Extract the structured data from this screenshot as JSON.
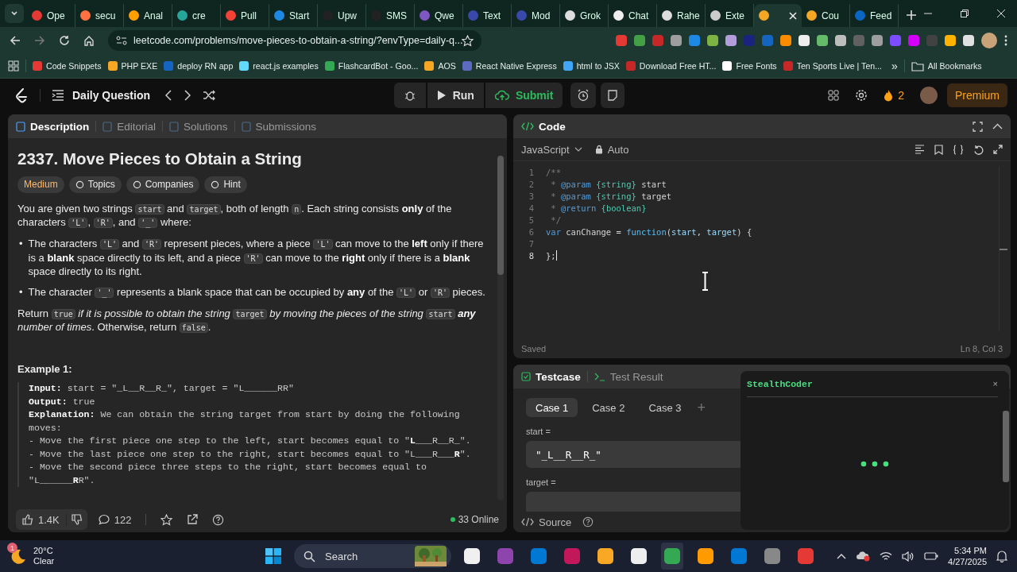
{
  "browser": {
    "tabs": [
      {
        "label": "Ope",
        "selected": false
      },
      {
        "label": "secu",
        "selected": false
      },
      {
        "label": "Anal",
        "selected": false
      },
      {
        "label": "cre",
        "selected": false
      },
      {
        "label": "Pull",
        "selected": false
      },
      {
        "label": "Start",
        "selected": false
      },
      {
        "label": "Upw",
        "selected": false
      },
      {
        "label": "SMS",
        "selected": false
      },
      {
        "label": "Qwe",
        "selected": false
      },
      {
        "label": "Text",
        "selected": false
      },
      {
        "label": "Mod",
        "selected": false
      },
      {
        "label": "Grok",
        "selected": false
      },
      {
        "label": "Chat",
        "selected": false
      },
      {
        "label": "Rahe",
        "selected": false
      },
      {
        "label": "Exte",
        "selected": false
      },
      {
        "selected": true
      },
      {
        "label": "Cou",
        "selected": false
      },
      {
        "label": "Feed",
        "selected": false
      }
    ],
    "url": "leetcode.com/problems/move-pieces-to-obtain-a-string/?envType=daily-q...",
    "bookmarks": [
      "Code Snippets",
      "PHP EXE",
      "deploy RN app",
      "react.js examples",
      "FlashcardBot - Goo...",
      "AOS",
      "React Native Express",
      "html to JSX",
      "Download Free HT...",
      "Free Fonts",
      "Ten Sports Live | Ten..."
    ],
    "overflow": "»",
    "all_bookmarks": "All Bookmarks"
  },
  "leetcode": {
    "title": "Daily Question",
    "run": "Run",
    "submit": "Submit",
    "streak": "2",
    "premium": "Premium"
  },
  "description": {
    "tabs": [
      {
        "label": "Description",
        "selected": true
      },
      {
        "label": "Editorial",
        "selected": false
      },
      {
        "label": "Solutions",
        "selected": false
      },
      {
        "label": "Submissions",
        "selected": false
      }
    ],
    "title": "2337. Move Pieces to Obtain a String",
    "difficulty": "Medium",
    "chips": [
      "Topics",
      "Companies",
      "Hint"
    ],
    "intro": [
      {
        "kind": "text",
        "text": "You are given two strings "
      },
      {
        "kind": "code",
        "text": "start"
      },
      {
        "kind": "text",
        "text": " and "
      },
      {
        "kind": "code",
        "text": "target"
      },
      {
        "kind": "text",
        "text": ", both of length "
      },
      {
        "kind": "code",
        "text": "n"
      },
      {
        "kind": "text",
        "text": ". Each string consists "
      },
      {
        "kind": "bold",
        "text": "only"
      },
      {
        "kind": "text",
        "text": " of the characters "
      },
      {
        "kind": "code",
        "text": "'L'"
      },
      {
        "kind": "text",
        "text": ", "
      },
      {
        "kind": "code",
        "text": "'R'"
      },
      {
        "kind": "text",
        "text": ", and "
      },
      {
        "kind": "code",
        "text": "'_'"
      },
      {
        "kind": "text",
        "text": " where:"
      }
    ],
    "bullets": [
      {
        "marker": "•",
        "segments": [
          {
            "kind": "text",
            "text": "The characters "
          },
          {
            "kind": "code",
            "text": "'L'"
          },
          {
            "kind": "text",
            "text": " and "
          },
          {
            "kind": "code",
            "text": "'R'"
          },
          {
            "kind": "text",
            "text": " represent pieces, where a piece "
          },
          {
            "kind": "code",
            "text": "'L'"
          },
          {
            "kind": "text",
            "text": " can move to the "
          },
          {
            "kind": "bold",
            "text": "left"
          },
          {
            "kind": "text",
            "text": " only if there is a "
          },
          {
            "kind": "bold",
            "text": "blank"
          },
          {
            "kind": "text",
            "text": " space directly to its left, and a piece "
          },
          {
            "kind": "code",
            "text": "'R'"
          },
          {
            "kind": "text",
            "text": " can move to the "
          },
          {
            "kind": "bold",
            "text": "right"
          },
          {
            "kind": "text",
            "text": " only if there is a "
          },
          {
            "kind": "bold",
            "text": "blank"
          },
          {
            "kind": "text",
            "text": " space directly to its right."
          }
        ]
      },
      {
        "marker": "•",
        "segments": [
          {
            "kind": "text",
            "text": "The character "
          },
          {
            "kind": "code",
            "text": "'_'"
          },
          {
            "kind": "text",
            "text": " represents a blank space that can be occupied by "
          },
          {
            "kind": "bold",
            "text": "any"
          },
          {
            "kind": "text",
            "text": " of the "
          },
          {
            "kind": "code",
            "text": "'L'"
          },
          {
            "kind": "text",
            "text": " or "
          },
          {
            "kind": "code",
            "text": "'R'"
          },
          {
            "kind": "text",
            "text": " pieces."
          }
        ]
      }
    ],
    "return": [
      {
        "kind": "text",
        "text": "Return "
      },
      {
        "kind": "code",
        "text": "true"
      },
      {
        "kind": "italic",
        "text": " if it is possible to obtain the string "
      },
      {
        "kind": "code",
        "text": "target"
      },
      {
        "kind": "italic",
        "text": " by moving the pieces of the string "
      },
      {
        "kind": "code",
        "text": "start"
      },
      {
        "kind": "bolditalic",
        "text": " any"
      },
      {
        "kind": "italic",
        "text": " number of times"
      },
      {
        "kind": "text",
        "text": ". Otherwise, return "
      },
      {
        "kind": "code",
        "text": "false"
      },
      {
        "kind": "text",
        "text": "."
      }
    ],
    "example_title": "Example 1:",
    "example_lines": [
      [
        {
          "kind": "bold",
          "text": "Input:"
        },
        {
          "kind": "text",
          "text": " start = \"_L__R__R_\", target = \"L______RR\""
        }
      ],
      [
        {
          "kind": "bold",
          "text": "Output:"
        },
        {
          "kind": "text",
          "text": " true"
        }
      ],
      [
        {
          "kind": "bold",
          "text": "Explanation:"
        },
        {
          "kind": "text",
          "text": " We can obtain the string target from start by doing the following moves:"
        }
      ],
      [
        {
          "kind": "text",
          "text": "- Move the first piece one step to the left, start becomes equal to \""
        },
        {
          "kind": "bold",
          "text": "L"
        },
        {
          "kind": "text",
          "text": "___R__R_\"."
        }
      ],
      [
        {
          "kind": "text",
          "text": "- Move the last piece one step to the right, start becomes equal to \"L___R___"
        },
        {
          "kind": "bold",
          "text": "R"
        },
        {
          "kind": "text",
          "text": "\"."
        }
      ],
      [
        {
          "kind": "text",
          "text": "- Move the second piece three steps to the right, start becomes equal to \"L______"
        },
        {
          "kind": "bold",
          "text": "R"
        },
        {
          "kind": "text",
          "text": "R\"."
        }
      ]
    ],
    "likes": "1.4K",
    "comments": "122",
    "online": "33 Online"
  },
  "editor": {
    "title": "Code",
    "language": "JavaScript",
    "mode": "Auto",
    "lines": [
      {
        "number": "1",
        "cursor": false,
        "tokens": [
          {
            "kind": "comment",
            "text": "/**"
          }
        ]
      },
      {
        "number": "2",
        "cursor": false,
        "tokens": [
          {
            "kind": "comment",
            "text": " * "
          },
          {
            "kind": "tag",
            "text": "@param"
          },
          {
            "kind": "type",
            "text": " {string}"
          },
          {
            "kind": "plain",
            "text": " start"
          }
        ]
      },
      {
        "number": "3",
        "cursor": false,
        "tokens": [
          {
            "kind": "comment",
            "text": " * "
          },
          {
            "kind": "tag",
            "text": "@param"
          },
          {
            "kind": "type",
            "text": " {string}"
          },
          {
            "kind": "plain",
            "text": " target"
          }
        ]
      },
      {
        "number": "4",
        "cursor": false,
        "tokens": [
          {
            "kind": "comment",
            "text": " * "
          },
          {
            "kind": "tag",
            "text": "@return"
          },
          {
            "kind": "type",
            "text": " {boolean}"
          }
        ]
      },
      {
        "number": "5",
        "cursor": false,
        "tokens": [
          {
            "kind": "comment",
            "text": " */"
          }
        ]
      },
      {
        "number": "6",
        "cursor": false,
        "tokens": [
          {
            "kind": "keyword",
            "text": "var"
          },
          {
            "kind": "plain",
            "text": " canChange = "
          },
          {
            "kind": "fn",
            "text": "function"
          },
          {
            "kind": "plain",
            "text": "("
          },
          {
            "kind": "param",
            "text": "start"
          },
          {
            "kind": "plain",
            "text": ", "
          },
          {
            "kind": "param",
            "text": "target"
          },
          {
            "kind": "plain",
            "text": ") {"
          }
        ]
      },
      {
        "number": "7",
        "cursor": false
      },
      {
        "number": "8",
        "cursor": true,
        "tokens": [
          {
            "kind": "plain",
            "text": "};"
          }
        ]
      }
    ],
    "status": "Saved",
    "position": "Ln 8, Col 3"
  },
  "testcase": {
    "tabs": [
      {
        "label": "Testcase",
        "selected": true
      },
      {
        "label": "Test Result",
        "selected": false
      }
    ],
    "cases": [
      {
        "label": "Case 1",
        "selected": true
      },
      {
        "label": "Case 2",
        "selected": false
      },
      {
        "label": "Case 3",
        "selected": false
      }
    ],
    "add": "+",
    "params": [
      {
        "name": "start =",
        "value": "\"_L__R__R_\""
      },
      {
        "name": "target ="
      }
    ],
    "source": "Source"
  },
  "overlay": {
    "title": "StealthCoder",
    "close": "×",
    "loading": true
  },
  "taskbar": {
    "temp": "20°C",
    "condition": "Clear",
    "badge": "1",
    "search": "Search",
    "time": "5:34 PM",
    "date": "4/27/2025"
  }
}
